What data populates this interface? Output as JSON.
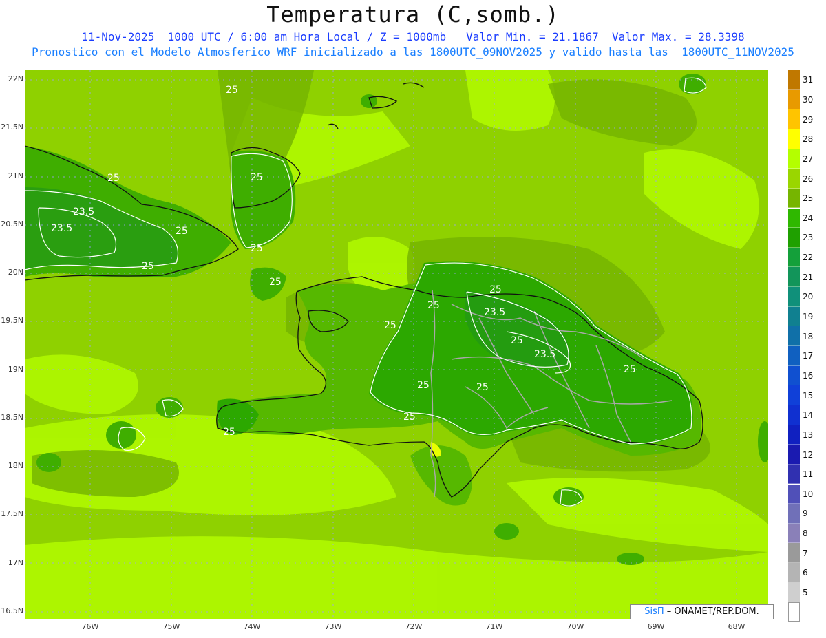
{
  "title": "Temperatura (C,somb.)",
  "subtitle_line1": "11-Nov-2025  1000 UTC / 6:00 am Hora Local / Z = 1000mb   Valor Min. = 21.1867  Valor Max. = 28.3398",
  "subtitle_line2": "Pronostico con el Modelo Atmosferico WRF inicializado a las 1800UTC_09NOV2025 y valido hasta las  1800UTC_11NOV2025",
  "lat_labels": [
    "22N",
    "21.5N",
    "21N",
    "20.5N",
    "20N",
    "19.5N",
    "19N",
    "18.5N",
    "18N",
    "17.5N",
    "17N",
    "16.5N"
  ],
  "lon_labels": [
    "76W",
    "75W",
    "74W",
    "73W",
    "72W",
    "71W",
    "70W",
    "69W",
    "68W"
  ],
  "contour_labels": [
    "25",
    "25",
    "23.5",
    "23.5",
    "25",
    "25",
    "25",
    "25",
    "25",
    "25",
    "23.5",
    "25",
    "25",
    "23.5",
    "25",
    "25",
    "25",
    "25",
    "25",
    "25"
  ],
  "colorbar": {
    "levels": [
      "31",
      "30",
      "29",
      "28",
      "27",
      "26",
      "25",
      "24",
      "23",
      "22",
      "21",
      "20",
      "19",
      "18",
      "17",
      "16",
      "15",
      "14",
      "13",
      "12",
      "11",
      "10",
      "9",
      "8",
      "7",
      "6",
      "5"
    ],
    "colors": [
      "#c07800",
      "#e89a00",
      "#ffc400",
      "#ffff00",
      "#b4ff00",
      "#9ad600",
      "#76b500",
      "#2fb800",
      "#1fa000",
      "#14a03a",
      "#12955a",
      "#10907a",
      "#108090",
      "#1070a8",
      "#1060c0",
      "#1050d0",
      "#1040d8",
      "#1030d0",
      "#1020c0",
      "#1a1ab0",
      "#3030b0",
      "#5050b8",
      "#7070b8",
      "#8a80b8",
      "#9a9a9a",
      "#b4b4b4",
      "#cfcfcf",
      "#ffffff"
    ]
  },
  "credit": {
    "brand": "SisΠ",
    "agency": " ONAMET/REP.DOM."
  },
  "colors": {
    "sea": "#93d600",
    "land_core": "#2fa800",
    "land_mid": "#56b800",
    "warm_sea": "#b6ff00",
    "contour": "#ffffff"
  }
}
